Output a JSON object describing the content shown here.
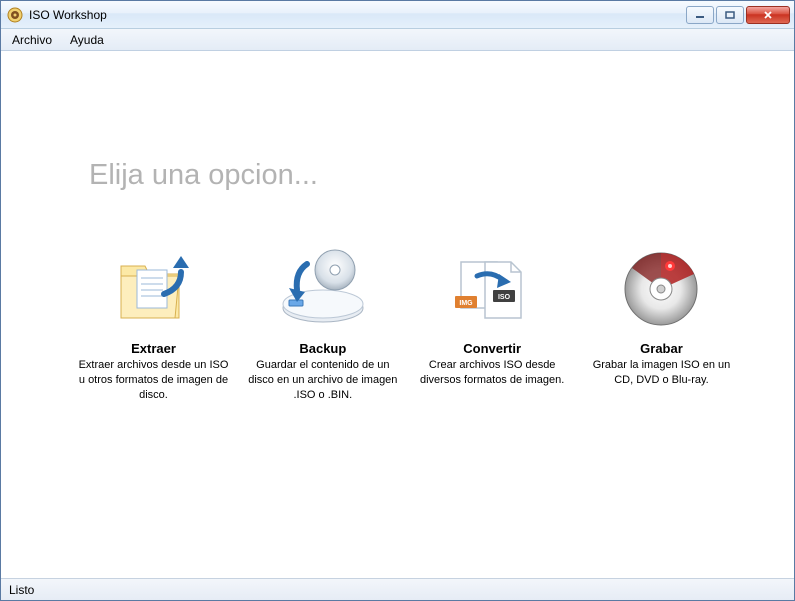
{
  "window": {
    "title": "ISO Workshop"
  },
  "menu": {
    "archivo": "Archivo",
    "ayuda": "Ayuda"
  },
  "heading": "Elija una opcion...",
  "options": {
    "extract": {
      "title": "Extraer",
      "desc": "Extraer archivos desde un ISO u otros formatos de imagen de disco."
    },
    "backup": {
      "title": "Backup",
      "desc": "Guardar el contenido de un disco en un archivo de imagen .ISO o .BIN."
    },
    "convert": {
      "title": "Convertir",
      "desc": "Crear archivos ISO desde diversos formatos de imagen."
    },
    "burn": {
      "title": "Grabar",
      "desc": "Grabar la imagen ISO en un CD, DVD o Blu-ray."
    }
  },
  "status": "Listo"
}
